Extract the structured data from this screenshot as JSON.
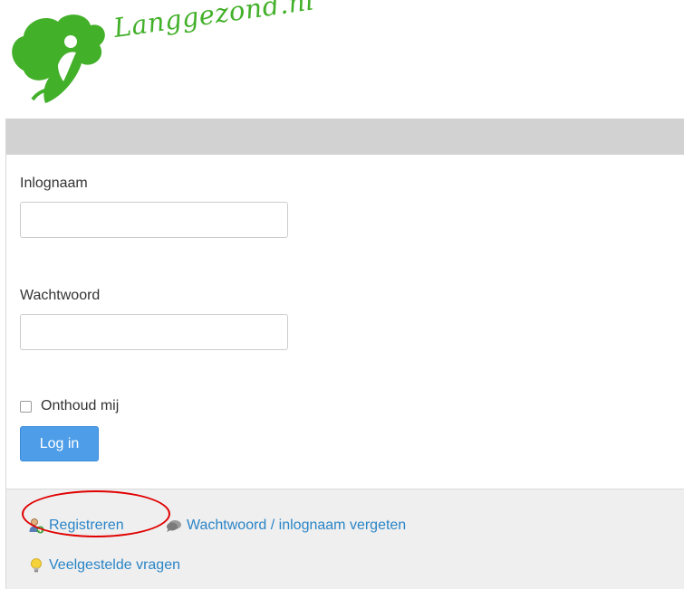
{
  "brand": {
    "logo_text": "Langgezond.nl"
  },
  "form": {
    "username_label": "Inlognaam",
    "username_value": "",
    "password_label": "Wachtwoord",
    "password_value": "",
    "remember_label": "Onthoud mij",
    "remember_checked": false,
    "submit_label": "Log in"
  },
  "footer": {
    "register_label": "Registreren",
    "forgot_label": "Wachtwoord / inlognaam vergeten",
    "faq_label": "Veelgestelde vragen"
  },
  "icons": {
    "logo": "tree-person-logo-icon",
    "register": "add-user-icon",
    "forgot": "speech-bubble-icon",
    "faq": "lightbulb-icon"
  },
  "colors": {
    "brand_green": "#43b02a",
    "button_blue": "#4d9de8",
    "link_blue": "#2a85c7",
    "annotation_red": "#e00000"
  }
}
